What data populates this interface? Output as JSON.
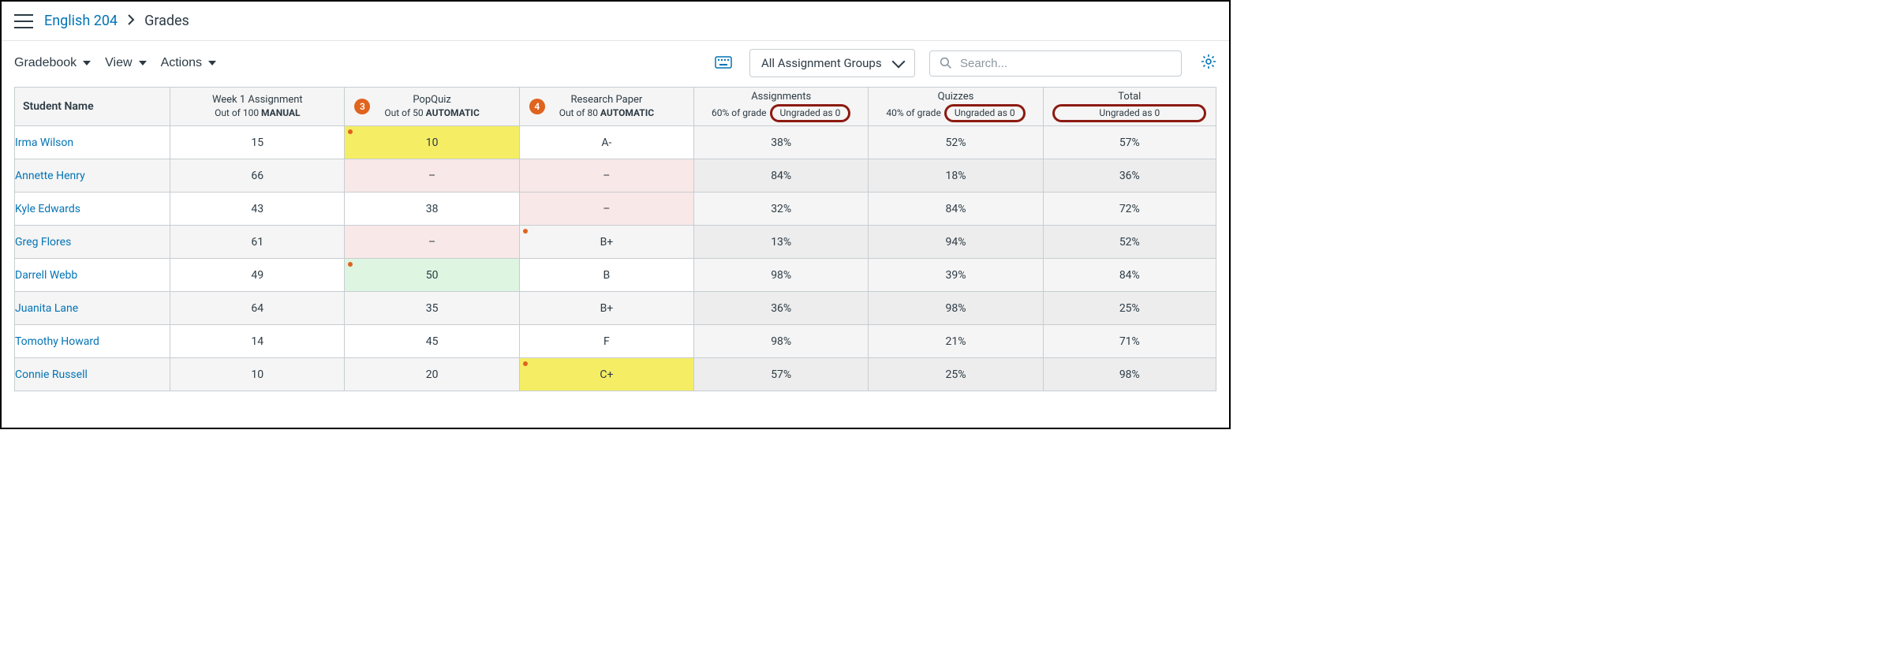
{
  "breadcrumb": {
    "course": "English 204",
    "page": "Grades"
  },
  "toolbar": {
    "gradebook": "Gradebook",
    "view": "View",
    "actions": "Actions",
    "filter_label": "All Assignment Groups",
    "search_placeholder": "Search..."
  },
  "columns": {
    "student": "Student Name",
    "assignment1": {
      "title": "Week 1 Assignment",
      "sub_prefix": "Out of 100 ",
      "sub_bold": "MANUAL"
    },
    "assignment2": {
      "badge": "3",
      "title": "PopQuiz",
      "sub_prefix": "Out of 50 ",
      "sub_bold": "AUTOMATIC"
    },
    "assignment3": {
      "badge": "4",
      "title": "Research Paper",
      "sub_prefix": "Out of 80 ",
      "sub_bold": "AUTOMATIC"
    },
    "group1": {
      "title": "Assignments",
      "weight": "60% of grade",
      "pill": "Ungraded as 0"
    },
    "group2": {
      "title": "Quizzes",
      "weight": "40% of grade",
      "pill": "Ungraded as 0"
    },
    "total": {
      "title": "Total",
      "pill": "Ungraded as 0"
    }
  },
  "rows": [
    {
      "name": "Irma Wilson",
      "a1": "15",
      "a2": "10",
      "a3": "A-",
      "g1": "38%",
      "g2": "52%",
      "tot": "57%",
      "a2_hl": "yellow",
      "a2_dot": true
    },
    {
      "name": "Annette Henry",
      "a1": "66",
      "a2": "–",
      "a3": "–",
      "g1": "84%",
      "g2": "18%",
      "tot": "36%",
      "a2_hl": "pink",
      "a3_hl": "pink"
    },
    {
      "name": "Kyle Edwards",
      "a1": "43",
      "a2": "38",
      "a3": "–",
      "g1": "32%",
      "g2": "84%",
      "tot": "72%",
      "a3_hl": "pink"
    },
    {
      "name": "Greg Flores",
      "a1": "61",
      "a2": "–",
      "a3": "B+",
      "g1": "13%",
      "g2": "94%",
      "tot": "52%",
      "a2_hl": "pink",
      "a3_dot": true
    },
    {
      "name": "Darrell Webb",
      "a1": "49",
      "a2": "50",
      "a3": "B",
      "g1": "98%",
      "g2": "39%",
      "tot": "84%",
      "a2_hl": "green",
      "a2_dot": true
    },
    {
      "name": "Juanita Lane",
      "a1": "64",
      "a2": "35",
      "a3": "B+",
      "g1": "36%",
      "g2": "98%",
      "tot": "25%"
    },
    {
      "name": "Tomothy Howard",
      "a1": "14",
      "a2": "45",
      "a3": "F",
      "g1": "98%",
      "g2": "21%",
      "tot": "71%"
    },
    {
      "name": "Connie Russell",
      "a1": "10",
      "a2": "20",
      "a3": "C+",
      "g1": "57%",
      "g2": "25%",
      "tot": "98%",
      "a3_hl": "yellow",
      "a3_dot": true
    }
  ]
}
